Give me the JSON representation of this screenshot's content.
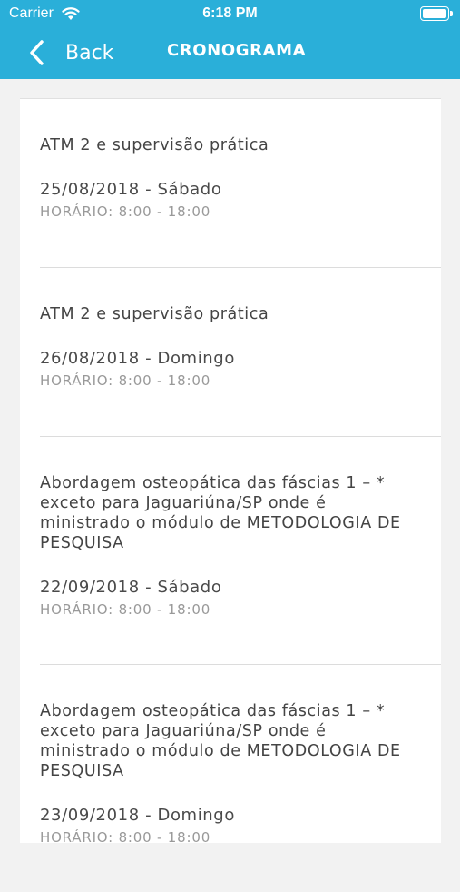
{
  "status_bar": {
    "carrier": "Carrier",
    "time": "6:18 PM"
  },
  "nav": {
    "back_label": "Back",
    "title": "CRONOGRAMA"
  },
  "entries": [
    {
      "title": "ATM 2 e supervisão prática",
      "date": "25/08/2018 - Sábado",
      "hours": "HORÁRIO: 8:00 - 18:00"
    },
    {
      "title": "ATM 2 e supervisão prática",
      "date": "26/08/2018 - Domingo",
      "hours": "HORÁRIO: 8:00 - 18:00"
    },
    {
      "title": "Abordagem osteopática das fáscias 1 – * exceto para Jaguariúna/SP onde é ministrado o módulo de METODOLOGIA DE PESQUISA",
      "date": "22/09/2018 - Sábado",
      "hours": "HORÁRIO: 8:00 - 18:00"
    },
    {
      "title": "Abordagem osteopática das fáscias 1 – * exceto para Jaguariúna/SP onde é ministrado o módulo de METODOLOGIA DE PESQUISA",
      "date": "23/09/2018 - Domingo",
      "hours": "HORÁRIO: 8:00 - 18:00"
    }
  ],
  "colors": {
    "nav_background": "#2aafd9",
    "page_background": "#f2f2f2"
  }
}
